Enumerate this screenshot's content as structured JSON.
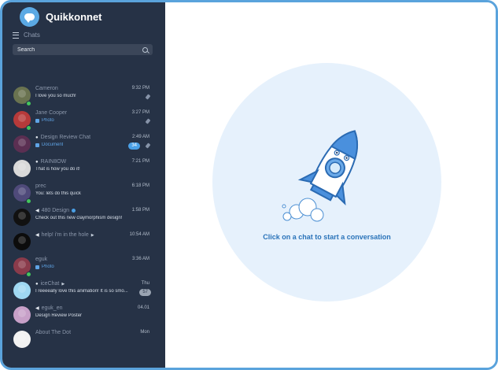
{
  "app": {
    "name": "Quikkonnet",
    "nav_label": "Chats",
    "search_placeholder": "Search"
  },
  "chats": [
    {
      "name": "Cameron",
      "time": "9:32 PM",
      "preview": "I love you so much!",
      "pinned": true,
      "online": true,
      "avatar_color": "#6a7350"
    },
    {
      "name": "Jane Cooper",
      "time": "3:27 PM",
      "preview": "Photo",
      "preview_type": "media",
      "pinned": true,
      "online": true,
      "avatar_color": "#b63a3a"
    },
    {
      "name": "Design Review Chat",
      "time": "2:49 AM",
      "preview": "Document",
      "preview_type": "media",
      "unread": "34",
      "pinned": true,
      "group": true,
      "avatar_color": "#5b2f52"
    },
    {
      "name": "RAIN8OW",
      "time": "7:21 PM",
      "preview": "That is how you do it!",
      "group": true,
      "avatar_color": "#d9d9d9"
    },
    {
      "name": "prec",
      "time": "6:18 PM",
      "preview": "You: lets do this quick",
      "online": true,
      "avatar_color": "#4f4a7a"
    },
    {
      "name": "480 Design",
      "time": "1:58 PM",
      "preview": "Check out this new claymorphism design!",
      "verified": true,
      "channel": true,
      "avatar_color": "#111111"
    },
    {
      "name": "help! i'm in the hole",
      "time": "10:54 AM",
      "preview": "",
      "muted": true,
      "channel": true,
      "avatar_color": "#0c0c0c"
    },
    {
      "name": "eguk",
      "time": "3:36 AM",
      "preview": "Photo",
      "preview_type": "media",
      "online": true,
      "avatar_color": "#8a3b4b"
    },
    {
      "name": "iceChat",
      "time": "Thu",
      "preview": "I reeeeally love this animation! It is so smo...",
      "unread": "57",
      "group": true,
      "muted": true,
      "avatar_color": "#9fd8f2"
    },
    {
      "name": "eguk_en",
      "time": "04.01",
      "preview": "Design Review Poster",
      "channel": true,
      "avatar_color": "#c7a0c8"
    },
    {
      "name": "About The Dot",
      "time": "Mon",
      "preview": "",
      "avatar_color": "#f2f2f2"
    }
  ],
  "main": {
    "empty_message": "Click on a chat to start a conversation"
  },
  "colors": {
    "sidebar_bg": "#263246",
    "accent": "#2a73b9",
    "circle_bg": "#e6f1fc",
    "border": "#5aa3dc"
  }
}
